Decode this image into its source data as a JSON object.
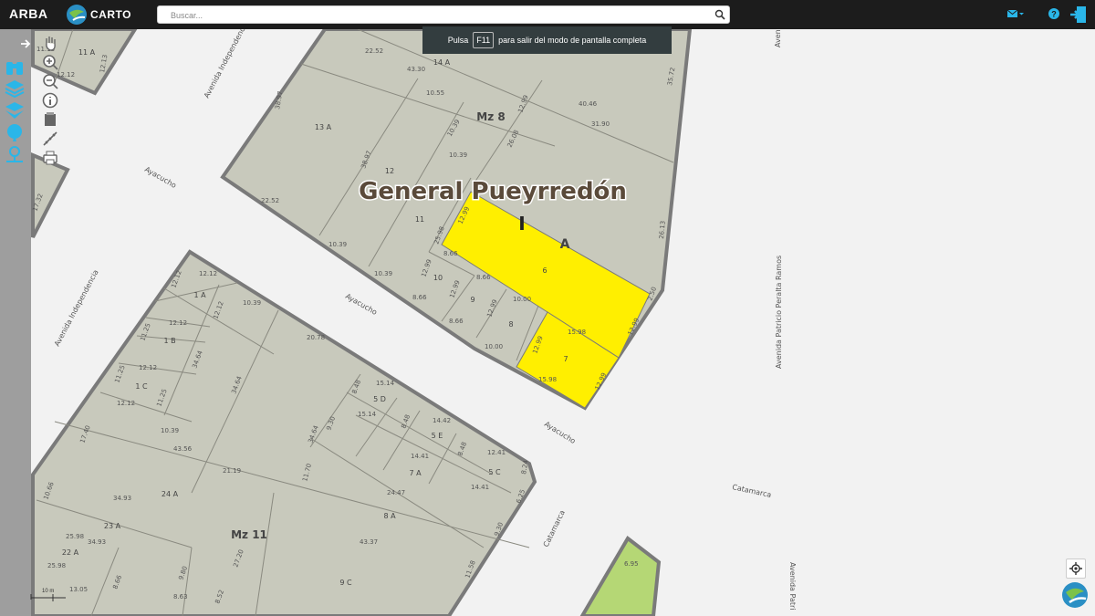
{
  "header": {
    "brand": "ARBA",
    "logo_text": "CARTO",
    "search_placeholder": "Buscar..."
  },
  "fullscreen_notice": {
    "before": "Pulsa",
    "key": "F11",
    "after": "para salir del modo de pantalla completa"
  },
  "map": {
    "partido": "General Pueyrredón",
    "seccion": "I",
    "seccion_letter": "A",
    "manzanas": [
      "Mz 8",
      "Mz 11"
    ],
    "streets": {
      "ayacucho": "Ayacucho",
      "av_independencia": "Avenida Independencia",
      "catamarca": "Catamarca",
      "av_peralta_ramos": "Avenida Patricio Peralta Ramos",
      "av_patricio_cut": "Avenida Patri",
      "av_top_cut": "Avenid"
    },
    "parcels": {
      "p11A": "11 A",
      "p14A": "14 A",
      "p13A": "13 A",
      "p12": "12",
      "p11": "11",
      "p10": "10",
      "p9": "9",
      "p8": "8",
      "p6": "6",
      "p7": "7",
      "p1A": "1 A",
      "p1B": "1 B",
      "p1C": "1 C",
      "p5D": "5 D",
      "p5E": "5 E",
      "p5C": "5 C",
      "p7A": "7 A",
      "p8A": "8 A",
      "p24A": "24 A",
      "p23A": "23 A",
      "p22A": "22 A",
      "p9C": "9 C"
    },
    "dims": [
      "22.52",
      "43.30",
      "10.55",
      "35.72",
      "40.46",
      "31.90",
      "38.97",
      "12.99",
      "10.39",
      "26.08",
      "10.39",
      "38.97",
      "22.52",
      "10.39",
      "25.98",
      "8.66",
      "12.99",
      "10.39",
      "8.66",
      "12.99",
      "8.66",
      "8.66",
      "12.99",
      "10.00",
      "10.00",
      "12.99",
      "26.13",
      "2.50",
      "15.98",
      "12.99",
      "12.99",
      "15.98",
      "12.99",
      "12.12",
      "12.12",
      "12.12",
      "10.39",
      "12.12",
      "11.25",
      "34.64",
      "12.12",
      "11.25",
      "11.25",
      "12.12",
      "34.64",
      "20.78",
      "10.39",
      "15.14",
      "8.48",
      "15.14",
      "8.48",
      "14.42",
      "9.30",
      "34.64",
      "14.41",
      "8.48",
      "12.41",
      "43.56",
      "21.19",
      "11.70",
      "24.47",
      "14.41",
      "6.25",
      "8.24",
      "17.40",
      "10.66",
      "34.93",
      "25.98",
      "34.93",
      "25.98",
      "43.37",
      "9.30",
      "9.80",
      "27.20",
      "8.66",
      "13.05",
      "8.63",
      "8.52",
      "11.58",
      "6.95",
      "17.32",
      "12.12",
      "11.13",
      "12.13"
    ]
  },
  "scale": "10 m",
  "colors": {
    "parcel": "#c8c9bc",
    "border": "#7a7a7a",
    "highlight": "#ffef00",
    "green": "#b5d775",
    "street": "#f2f2f2",
    "topbar": "#1c1c1c",
    "accent": "#2ab6e8"
  },
  "icons": [
    "search-icon",
    "mail-icon",
    "help-icon",
    "logout-icon",
    "expand-icon",
    "binoculars-icon",
    "layers-icon",
    "layers-stack-icon",
    "globe-pin-icon",
    "user-pin-icon",
    "pan-icon",
    "zoom-in-icon",
    "zoom-out-icon",
    "info-icon",
    "select-icon",
    "measure-icon",
    "print-icon",
    "locate-icon",
    "carto-globe-icon"
  ]
}
